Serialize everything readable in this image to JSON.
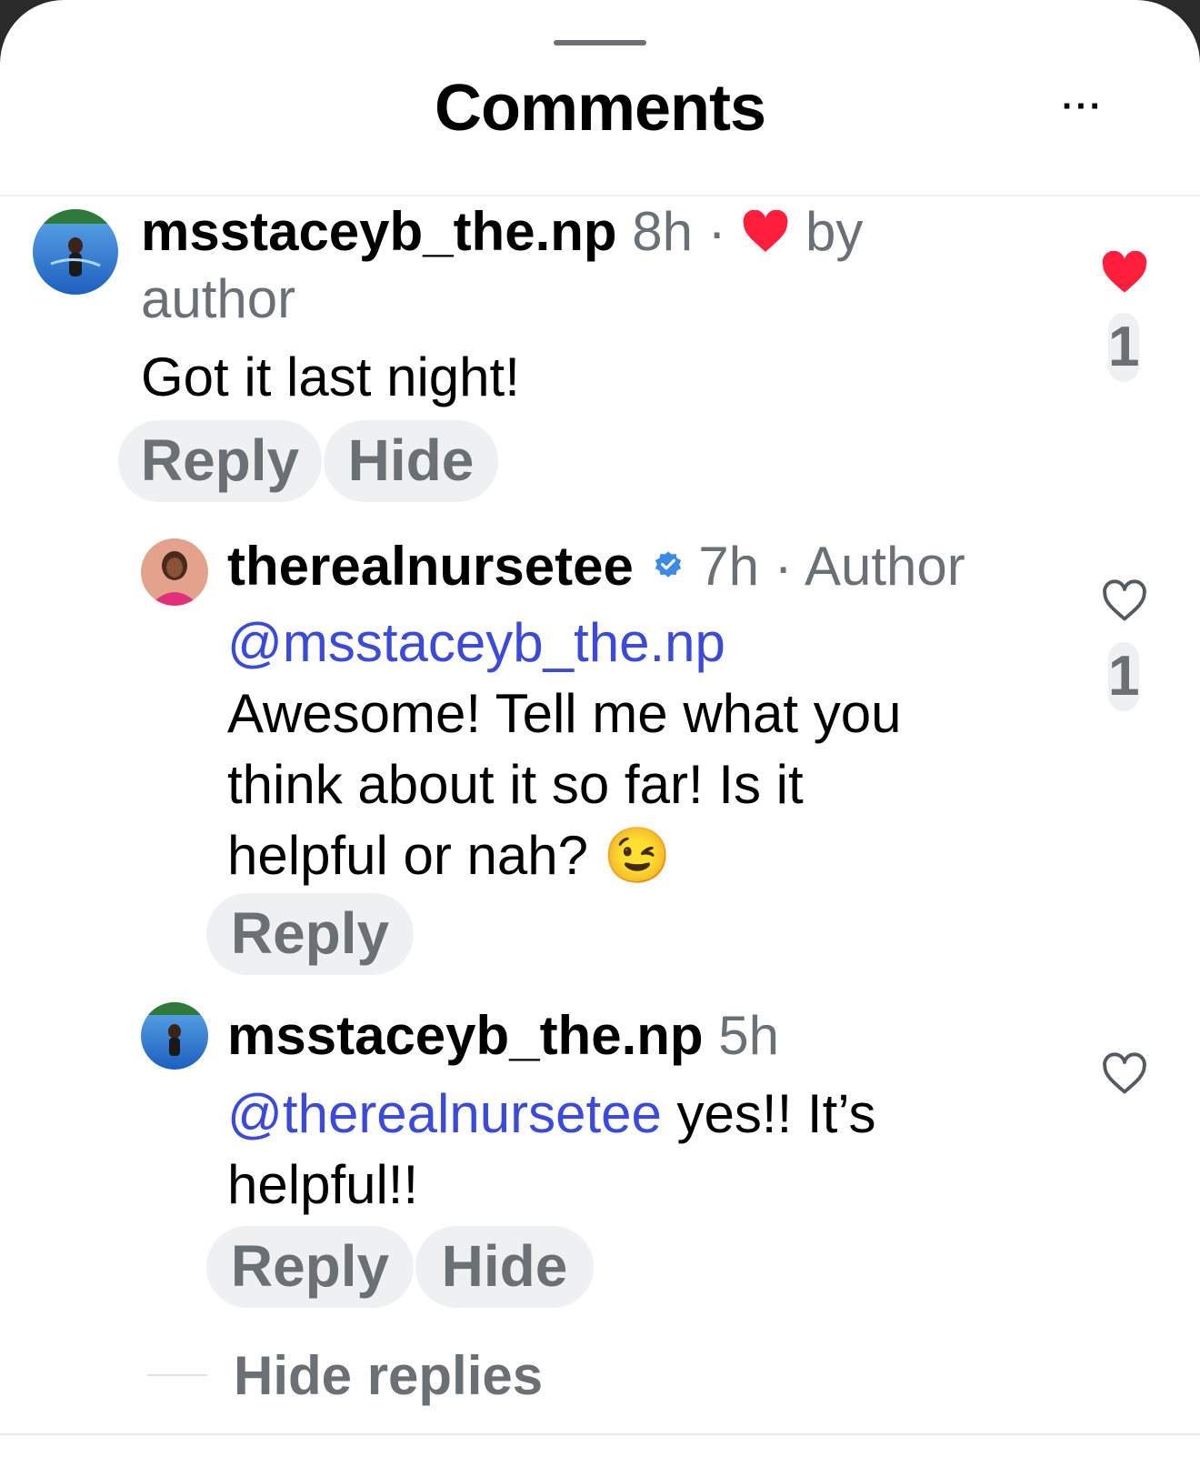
{
  "header": {
    "title": "Comments",
    "more_label": "···"
  },
  "comments": [
    {
      "username": "msstaceyb_the.np",
      "time": "8h",
      "sep": "·",
      "by_line_1": "by",
      "by_line_2": "author",
      "text": "Got it last night!",
      "like_count": "1",
      "liked": true,
      "actions": {
        "reply": "Reply",
        "hide": "Hide"
      }
    },
    {
      "username": "therealnursetee",
      "verified": true,
      "time": "7h",
      "sep": "·",
      "badge": "Author",
      "mention": "@msstaceyb_the.np",
      "text_lines": [
        "Awesome! Tell me what you",
        "think about it so far! Is it",
        "helpful or nah?"
      ],
      "emoji": "😉",
      "like_count": "1",
      "liked": false,
      "actions": {
        "reply": "Reply"
      }
    },
    {
      "username": "msstaceyb_the.np",
      "time": "5h",
      "mention": "@therealnursetee",
      "text_after_mention": " yes!! It’s",
      "text_line_2": "helpful!!",
      "liked": false,
      "actions": {
        "reply": "Reply",
        "hide": "Hide"
      }
    }
  ],
  "hide_replies_label": "Hide replies",
  "colors": {
    "like_red": "#ff1f3d",
    "mention_blue": "#3b4ad8",
    "verified_blue": "#3d8ae6",
    "meta_gray": "#6b7075"
  },
  "icons": [
    "heart-filled-icon",
    "heart-outline-icon",
    "verified-badge-icon",
    "more-icon"
  ]
}
